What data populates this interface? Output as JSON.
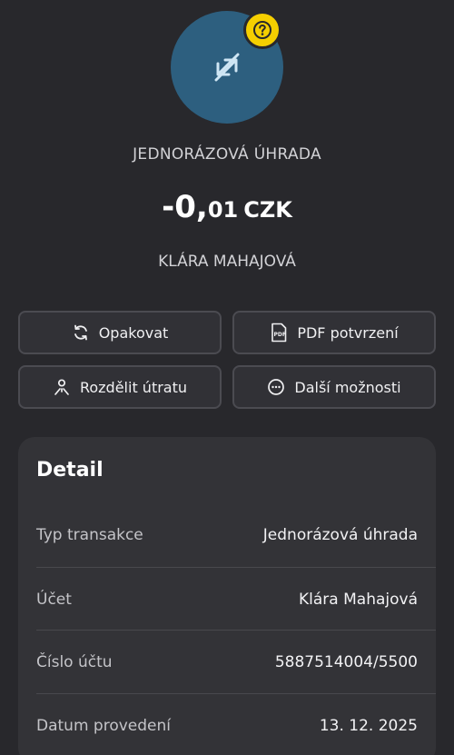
{
  "header": {
    "transaction_type": "JEDNORÁZOVÁ ÚHRADA",
    "amount_main": "-0,",
    "amount_decimal": "01",
    "currency": "CZK",
    "counterparty": "KLÁRA MAHAJOVÁ",
    "avatar_icon": "transfer-arrows-icon",
    "badge_icon": "question-icon"
  },
  "actions": {
    "repeat": "Opakovat",
    "pdf": "PDF potvrzení",
    "split": "Rozdělit útratu",
    "more": "Další možnosti"
  },
  "detail": {
    "title": "Detail",
    "rows": [
      {
        "label": "Typ transakce",
        "value": "Jednorázová úhrada"
      },
      {
        "label": "Účet",
        "value": "Klára Mahajová"
      },
      {
        "label": "Číslo účtu",
        "value": "5887514004/5500"
      },
      {
        "label": "Datum provedení",
        "value": "13. 12. 2025"
      }
    ]
  },
  "colors": {
    "background": "#28282c",
    "avatar": "#2d5f7f",
    "badge": "#f5cf00",
    "card": "#333337"
  }
}
